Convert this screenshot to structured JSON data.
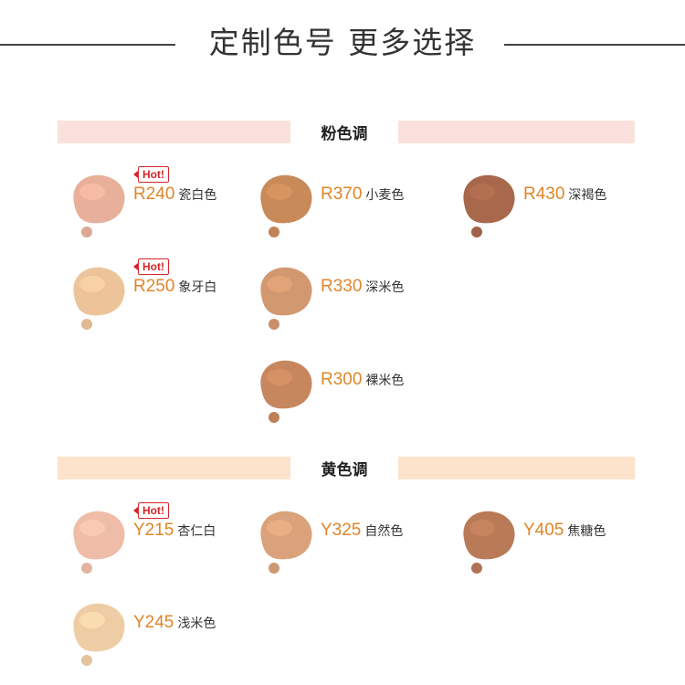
{
  "header": {
    "title": "定制色号  更多选择"
  },
  "sections": [
    {
      "title": "粉色调",
      "band_color": "#fbe1dd",
      "items": [
        {
          "code": "R240",
          "name": "瓷白色",
          "hot": "Hot!",
          "color": "#e8b09a"
        },
        {
          "code": "R370",
          "name": "小麦色",
          "color": "#c98a5a"
        },
        {
          "code": "R430",
          "name": "深褐色",
          "color": "#a8684b"
        },
        {
          "code": "R250",
          "name": "象牙白",
          "hot": "Hot!",
          "color": "#edc49a"
        },
        {
          "code": "R330",
          "name": "深米色",
          "color": "#d29870"
        },
        {
          "code": "R300",
          "name": "裸米色",
          "color": "#c7875e"
        }
      ]
    },
    {
      "title": "黄色调",
      "band_color": "#fde3cc",
      "items": [
        {
          "code": "Y215",
          "name": "杏仁白",
          "hot": "Hot!",
          "color": "#efbca7"
        },
        {
          "code": "Y325",
          "name": "自然色",
          "color": "#d9a27a"
        },
        {
          "code": "Y405",
          "name": "焦糖色",
          "color": "#b87a57"
        },
        {
          "code": "Y245",
          "name": "浅米色",
          "color": "#efcda4"
        }
      ]
    }
  ]
}
